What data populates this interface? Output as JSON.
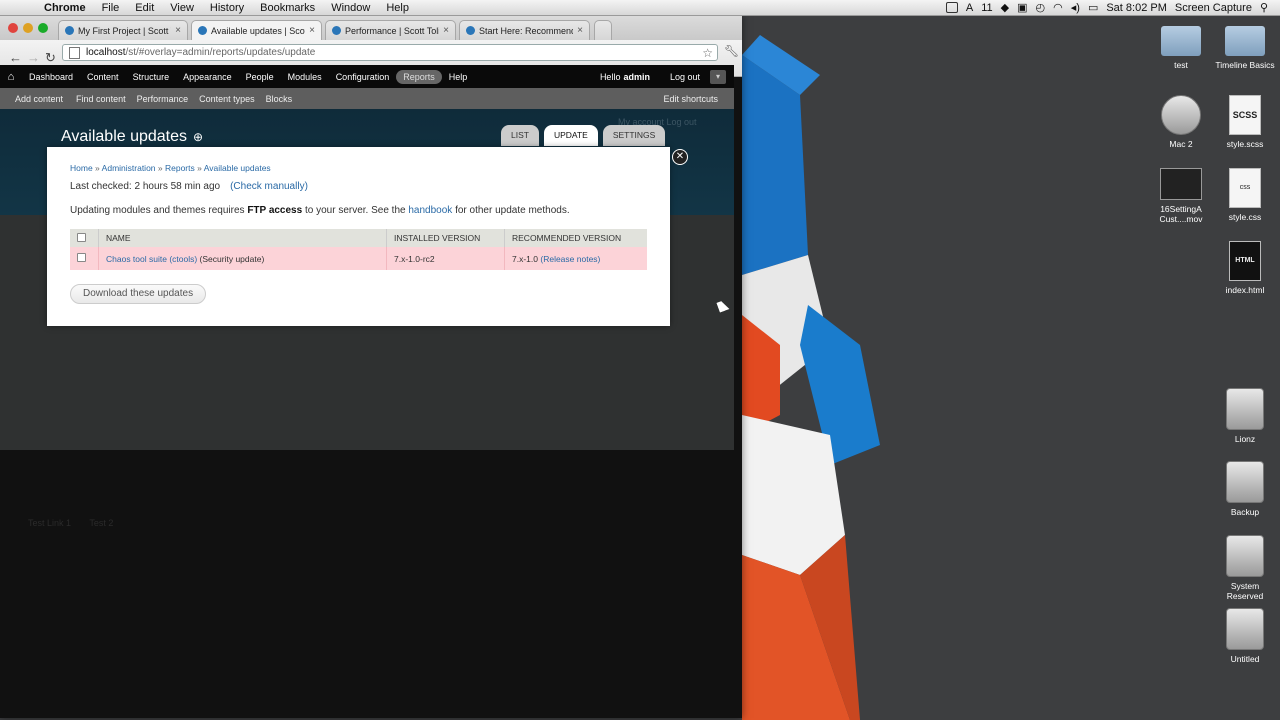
{
  "menubar": {
    "app": "Chrome",
    "items": [
      "File",
      "Edit",
      "View",
      "History",
      "Bookmarks",
      "Window",
      "Help"
    ],
    "clock": "Sat 8:02 PM",
    "capture": "Screen Capture",
    "num": "11"
  },
  "browser": {
    "tabs": [
      {
        "title": "My First Project | Scott Tolin"
      },
      {
        "title": "Available updates | Scott To"
      },
      {
        "title": "Performance | Scott Tolinski"
      },
      {
        "title": "Start Here: Recommended M"
      }
    ],
    "address": {
      "host": "localhost",
      "path": "/st/#overlay=admin/reports/updates/update"
    }
  },
  "drupal_toolbar": {
    "items": [
      "Dashboard",
      "Content",
      "Structure",
      "Appearance",
      "People",
      "Modules",
      "Configuration",
      "Reports",
      "Help"
    ],
    "hello": "Hello",
    "user": "admin",
    "logout": "Log out"
  },
  "shortcuts": {
    "items": [
      "Add content",
      "Find content",
      "Performance",
      "Content types",
      "Blocks"
    ],
    "edit": "Edit shortcuts"
  },
  "overlay": {
    "title": "Available updates",
    "tabs": [
      "LIST",
      "UPDATE",
      "SETTINGS"
    ],
    "ghost_top": "My account    Log out",
    "ghost_links": [
      "Test Link 1",
      "Test 2"
    ]
  },
  "dialog": {
    "breadcrumb": [
      "Home",
      "Administration",
      "Reports",
      "Available updates"
    ],
    "last_checked": "Last checked: 2 hours 58 min ago",
    "check_manually": "(Check manually)",
    "ftp_pre": "Updating modules and themes requires ",
    "ftp_bold": "FTP access",
    "ftp_mid": " to your server. See the ",
    "ftp_link": "handbook",
    "ftp_post": " for other update methods.",
    "table": {
      "headers": [
        "NAME",
        "INSTALLED VERSION",
        "RECOMMENDED VERSION"
      ],
      "row": {
        "name_link": "Chaos tool suite (ctools)",
        "name_suffix": " (Security update)",
        "installed": "7.x-1.0-rc2",
        "recommended": "7.x-1.0",
        "release_notes": "(Release notes)"
      }
    },
    "download_button": "Download these updates"
  },
  "desktop_icons": [
    {
      "label": "test"
    },
    {
      "label": "Timeline Basics"
    },
    {
      "label": "Mac 2"
    },
    {
      "label": "style.scss",
      "badge": "SCSS"
    },
    {
      "label": "16SettingA Cust....mov"
    },
    {
      "label": "style.css",
      "badge": "css"
    },
    {
      "label": "index.html",
      "badge": "HTML"
    },
    {
      "label": "Lionz"
    },
    {
      "label": "Backup"
    },
    {
      "label": "System Reserved"
    },
    {
      "label": "Untitled"
    }
  ]
}
